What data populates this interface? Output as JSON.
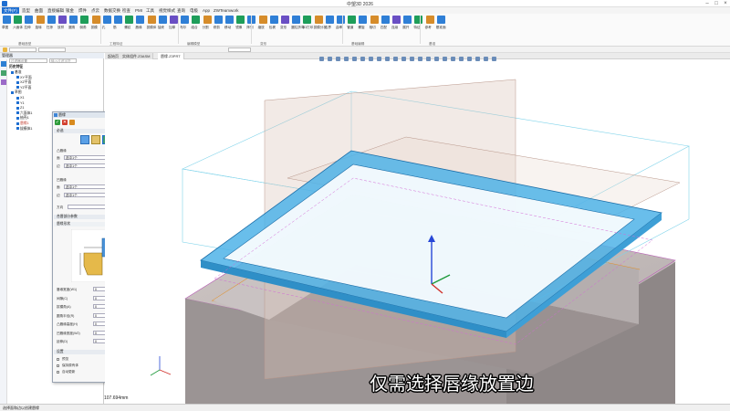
{
  "window": {
    "title": "中望3D 2026"
  },
  "menu": {
    "tabs": [
      "文件(F)",
      "造型",
      "曲面",
      "直接编辑",
      "钣金",
      "焊件",
      "点云",
      "数据交换",
      "检查",
      "PMI",
      "工具",
      "视觉样式",
      "查询",
      "电极",
      "App",
      "ZWTeamwork"
    ]
  },
  "ribbon": {
    "labels": [
      "草图",
      "六面体",
      "拉伸",
      "旋转",
      "扫掠",
      "放样",
      "圆角",
      "倒角",
      "拔模",
      "孔",
      "筋",
      "螺纹",
      "唇缘",
      "拔模体",
      "抽壳",
      "加厚",
      "布尔",
      "组合",
      "分割",
      "修剪",
      "移动",
      "镜像",
      "阵列",
      "缩放",
      "包裹",
      "变形",
      "圆柱折弯",
      "3D打印",
      "拔模分析",
      "边界",
      "曲率",
      "管道",
      "螺旋",
      "相切",
      "匹配",
      "连续",
      "展开",
      "特征",
      "参考",
      "基准面"
    ],
    "groups": [
      "基础造型",
      "工程特征",
      "编辑模型",
      "变形",
      "基础编辑",
      "基准"
    ]
  },
  "doc_tabs": [
    "起始页",
    "实体组件.Z3ASM",
    "唇缘.Z3PRT"
  ],
  "left_panel": {
    "header": "管理器",
    "search_placeholder": "输入过滤字符",
    "tree_title": "历史特征",
    "items": [
      "基准",
      "XY平面",
      "XZ平面",
      "YZ平面",
      "草图",
      "X1",
      "Y1",
      "Z1",
      "六面体1",
      "抽壳1",
      "唇缘1",
      "拔模体1"
    ]
  },
  "dialog": {
    "title": "唇缘",
    "sections": {
      "required": "必选",
      "lip_params": "合唇部分参数",
      "lip_shape": "唇缘形状",
      "settings": "设置"
    },
    "fields": {
      "face_label": "面",
      "face_value": "选中1个",
      "edge_label": "边",
      "edge_value": "选中1个",
      "group_a": "凸唇缘",
      "group_b": "凹唇缘",
      "direction_label": "方向"
    },
    "params": [
      {
        "label": "唇缘宽度(W1)",
        "value": "0",
        "unit": "mm"
      },
      {
        "label": "间隙(C)",
        "value": "0",
        "unit": "mm"
      },
      {
        "label": "拔模角(A)",
        "value": "0",
        "unit": "deg"
      },
      {
        "label": "圆角半径(R)",
        "value": "0",
        "unit": "mm"
      },
      {
        "label": "凸唇缘高度(H)",
        "value": "0",
        "unit": "mm"
      },
      {
        "label": "凹唇缘宽度(W2)",
        "value": "0",
        "unit": "mm"
      },
      {
        "label": "延伸(D)",
        "value": "0",
        "unit": "mm"
      }
    ],
    "settings": [
      "预览",
      "保持原有体",
      "自动更新"
    ]
  },
  "viewport": {
    "measure": "107.694mm",
    "caption": "仅需选择唇缘放置边"
  },
  "status": {
    "text": "选择面和边以创建唇缘"
  },
  "colors": {
    "accent": "#1f6fd1",
    "lip": "#4fb3e8",
    "body": "#c9c3c2",
    "edge": "#e0902a"
  }
}
